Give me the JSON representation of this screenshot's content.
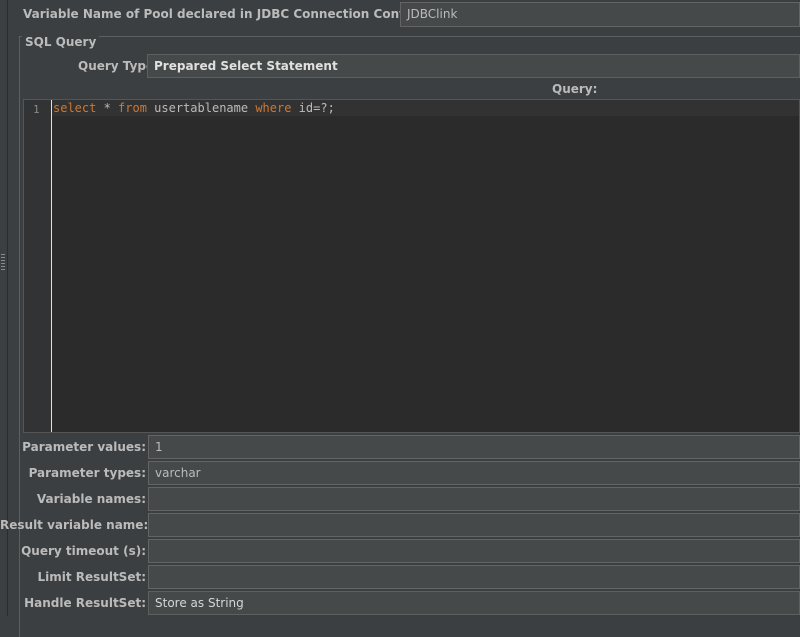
{
  "pool": {
    "label": "Variable Name of Pool declared in JDBC Connection Configuration:",
    "value": "JDBClink"
  },
  "sql_query": {
    "legend": "SQL Query",
    "query_type_label": "Query Type:",
    "query_type_value": "Prepared Select Statement",
    "query_column_header": "Query:",
    "editor": {
      "line_numbers": [
        "1"
      ],
      "tokens": {
        "t1": "select",
        "t2": " * ",
        "t3": "from",
        "t4": " usertablename ",
        "t5": "where",
        "t6": " id=?;"
      }
    }
  },
  "params": [
    {
      "label": "Parameter values:",
      "value": "1"
    },
    {
      "label": "Parameter types:",
      "value": "varchar"
    },
    {
      "label": "Variable names:",
      "value": ""
    },
    {
      "label": "Result variable name:",
      "value": ""
    },
    {
      "label": "Query timeout (s):",
      "value": ""
    },
    {
      "label": "Limit ResultSet:",
      "value": ""
    },
    {
      "label": "Handle ResultSet:",
      "value": "Store as String"
    }
  ],
  "colors": {
    "background": "#3c3f41",
    "editor_bg": "#2b2b2b",
    "keyword": "#cc7832",
    "text": "#bbbbbb"
  }
}
